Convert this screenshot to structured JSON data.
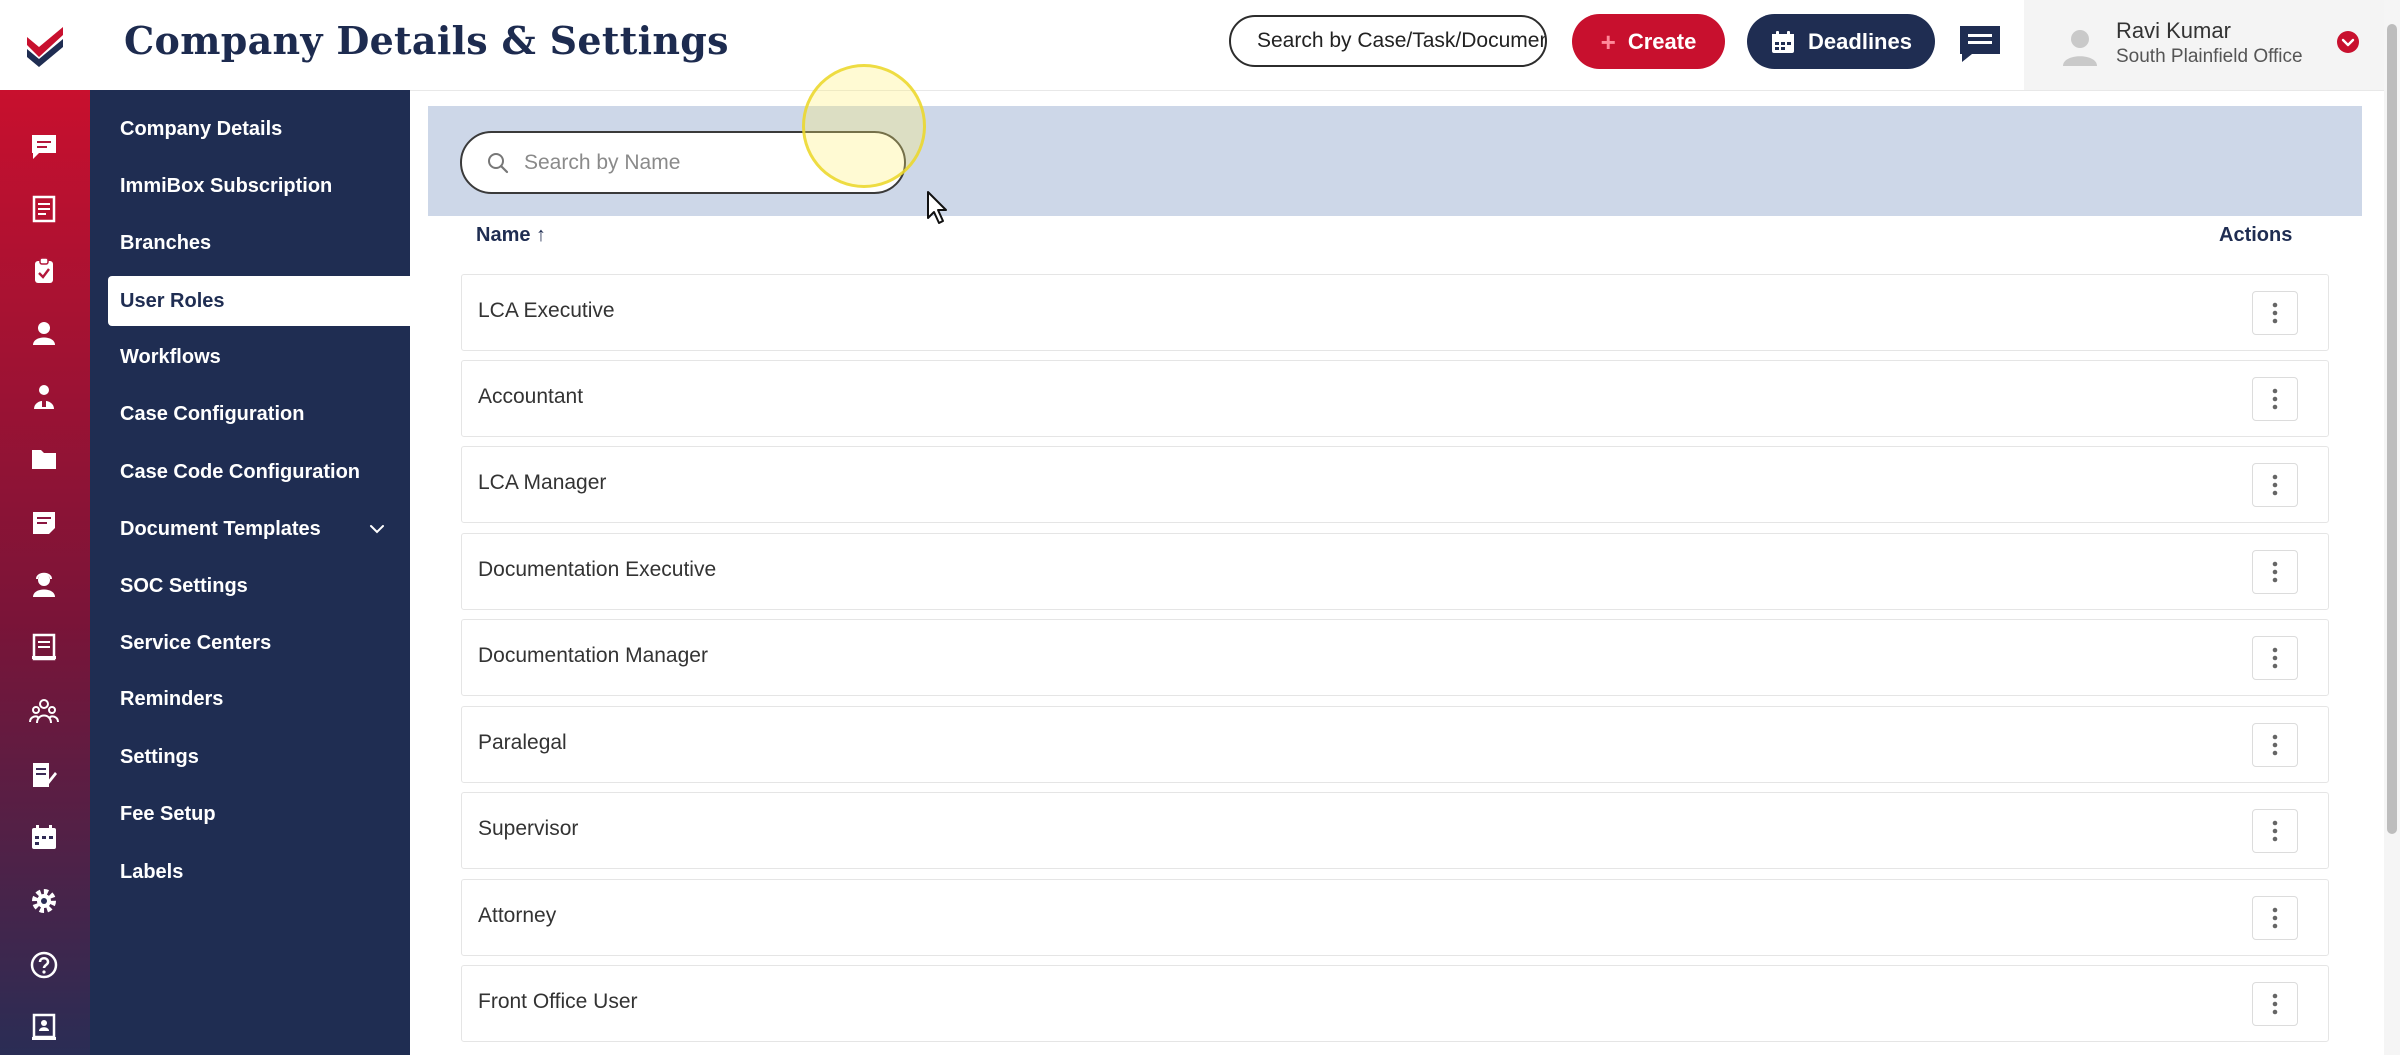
{
  "header": {
    "title": "Company Details & Settings",
    "search_placeholder": "Search by Case/Task/Document",
    "create_label": "Create",
    "deadlines_label": "Deadlines",
    "user_name": "Ravi Kumar",
    "user_office": "South Plainfield Office"
  },
  "rail_icons": [
    "messages-icon",
    "notebook-icon",
    "clipboard-icon",
    "person-icon",
    "group-icon",
    "folder-icon",
    "notes-icon",
    "agent-icon",
    "document-icon",
    "users-icon",
    "edit-doc-icon",
    "calendar-icon",
    "gear-icon",
    "help-icon",
    "book-icon"
  ],
  "menu": {
    "items": [
      {
        "label": "Company Details"
      },
      {
        "label": "ImmiBox Subscription"
      },
      {
        "label": "Branches"
      },
      {
        "label": "User Roles",
        "active": true
      },
      {
        "label": "Workflows"
      },
      {
        "label": "Case Configuration"
      },
      {
        "label": "Case Code Configuration"
      },
      {
        "label": "Document Templates",
        "expandable": true
      },
      {
        "label": "SOC Settings"
      },
      {
        "label": "Service Centers"
      },
      {
        "label": "Reminders"
      },
      {
        "label": "Settings"
      },
      {
        "label": "Fee Setup"
      },
      {
        "label": "Labels"
      }
    ]
  },
  "main": {
    "search_placeholder": "Search by Name",
    "col_name": "Name",
    "col_name_sort": "↑",
    "col_actions": "Actions",
    "rows": [
      {
        "name": "LCA Executive"
      },
      {
        "name": "Accountant"
      },
      {
        "name": "LCA Manager"
      },
      {
        "name": "Documentation Executive"
      },
      {
        "name": "Documentation Manager"
      },
      {
        "name": "Paralegal"
      },
      {
        "name": "Supervisor"
      },
      {
        "name": "Attorney"
      },
      {
        "name": "Front Office User"
      }
    ]
  },
  "colors": {
    "brand_navy": "#1f2d52",
    "brand_red": "#c8102e",
    "filter_bg": "#cdd7e8"
  }
}
